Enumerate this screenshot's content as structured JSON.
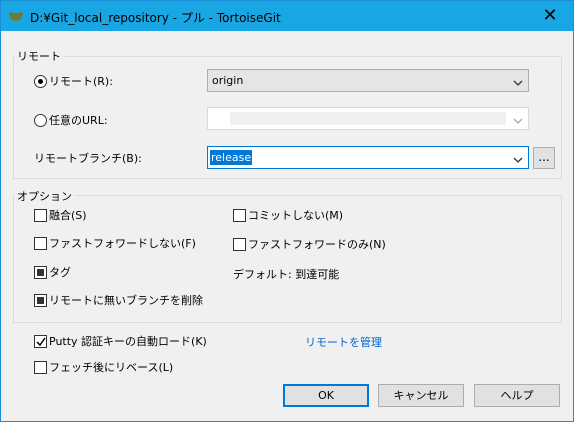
{
  "window": {
    "title": "D:¥Git_local_repository - プル - TortoiseGit",
    "close_glyph": "✕"
  },
  "remote_group": {
    "label": "リモート",
    "remote_radio_label": "リモート(R):",
    "remote_radio_checked": true,
    "remote_value": "origin",
    "url_radio_label": "任意のURL:",
    "url_radio_checked": false,
    "url_value": "",
    "branch_label": "リモートブランチ(B):",
    "branch_value": "release",
    "browse_label": "..."
  },
  "options_group": {
    "label": "オプション",
    "merge_label": "融合(S)",
    "merge_checked": false,
    "no_commit_label": "コミットしない(M)",
    "no_commit_checked": false,
    "no_ff_label": "ファストフォワードしない(F)",
    "no_ff_checked": false,
    "ff_only_label": "ファストフォワードのみ(N)",
    "ff_only_checked": false,
    "tags_label": "タグ",
    "tags_state": "indeterminate",
    "default_text": "デフォルト: 到達可能",
    "prune_label": "リモートに無いブランチを削除",
    "prune_state": "indeterminate"
  },
  "bottom": {
    "putty_label": "Putty 認証キーの自動ロード(K)",
    "putty_checked": true,
    "manage_remotes_link": "リモートを管理",
    "rebase_label": "フェッチ後にリベース(L)",
    "rebase_checked": false
  },
  "buttons": {
    "ok": "OK",
    "cancel": "キャンセル",
    "help": "ヘルプ"
  },
  "colors": {
    "titlebar": "#18a7e4",
    "accent": "#0078d7",
    "link": "#0066cc"
  }
}
